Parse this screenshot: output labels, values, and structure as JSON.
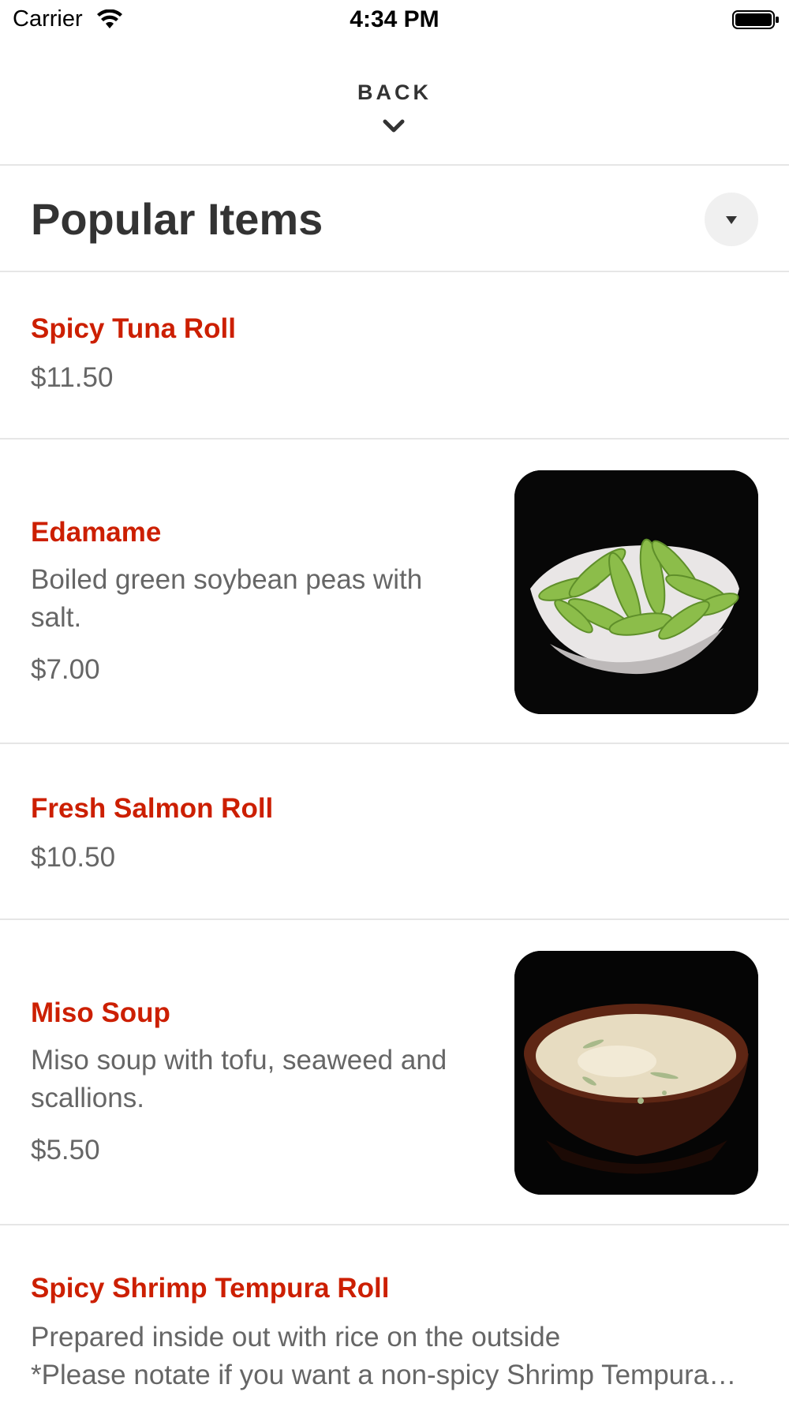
{
  "status_bar": {
    "carrier": "Carrier",
    "time": "4:34 PM",
    "icons": [
      "wifi-icon",
      "battery-icon"
    ]
  },
  "header": {
    "back_label": "BACK",
    "back_icon": "chevron-down-icon"
  },
  "section": {
    "title": "Popular Items",
    "toggle_icon": "triangle-down-icon"
  },
  "items": [
    {
      "name": "Spicy Tuna Roll",
      "description": "",
      "price": "$11.50",
      "photo": ""
    },
    {
      "name": "Edamame",
      "description": "Boiled green soybean peas with salt.",
      "price": "$7.00",
      "photo": "edamame-bowl"
    },
    {
      "name": "Fresh Salmon Roll",
      "description": "",
      "price": "$10.50",
      "photo": ""
    },
    {
      "name": "Miso Soup",
      "description": "Miso soup with tofu, seaweed and scallions.",
      "price": "$5.50",
      "photo": "miso-soup-bowl"
    },
    {
      "name": "Spicy Shrimp Tempura Roll",
      "description_line1": "Prepared inside out with rice on the outside",
      "description_line2": "*Please notate if you want a non-spicy Shrimp Tempura Roll",
      "price": "",
      "photo": ""
    }
  ],
  "colors": {
    "item_name": "#cc1f00",
    "text_secondary": "#666666",
    "text_primary": "#333333",
    "divider": "#e6e6e6"
  }
}
